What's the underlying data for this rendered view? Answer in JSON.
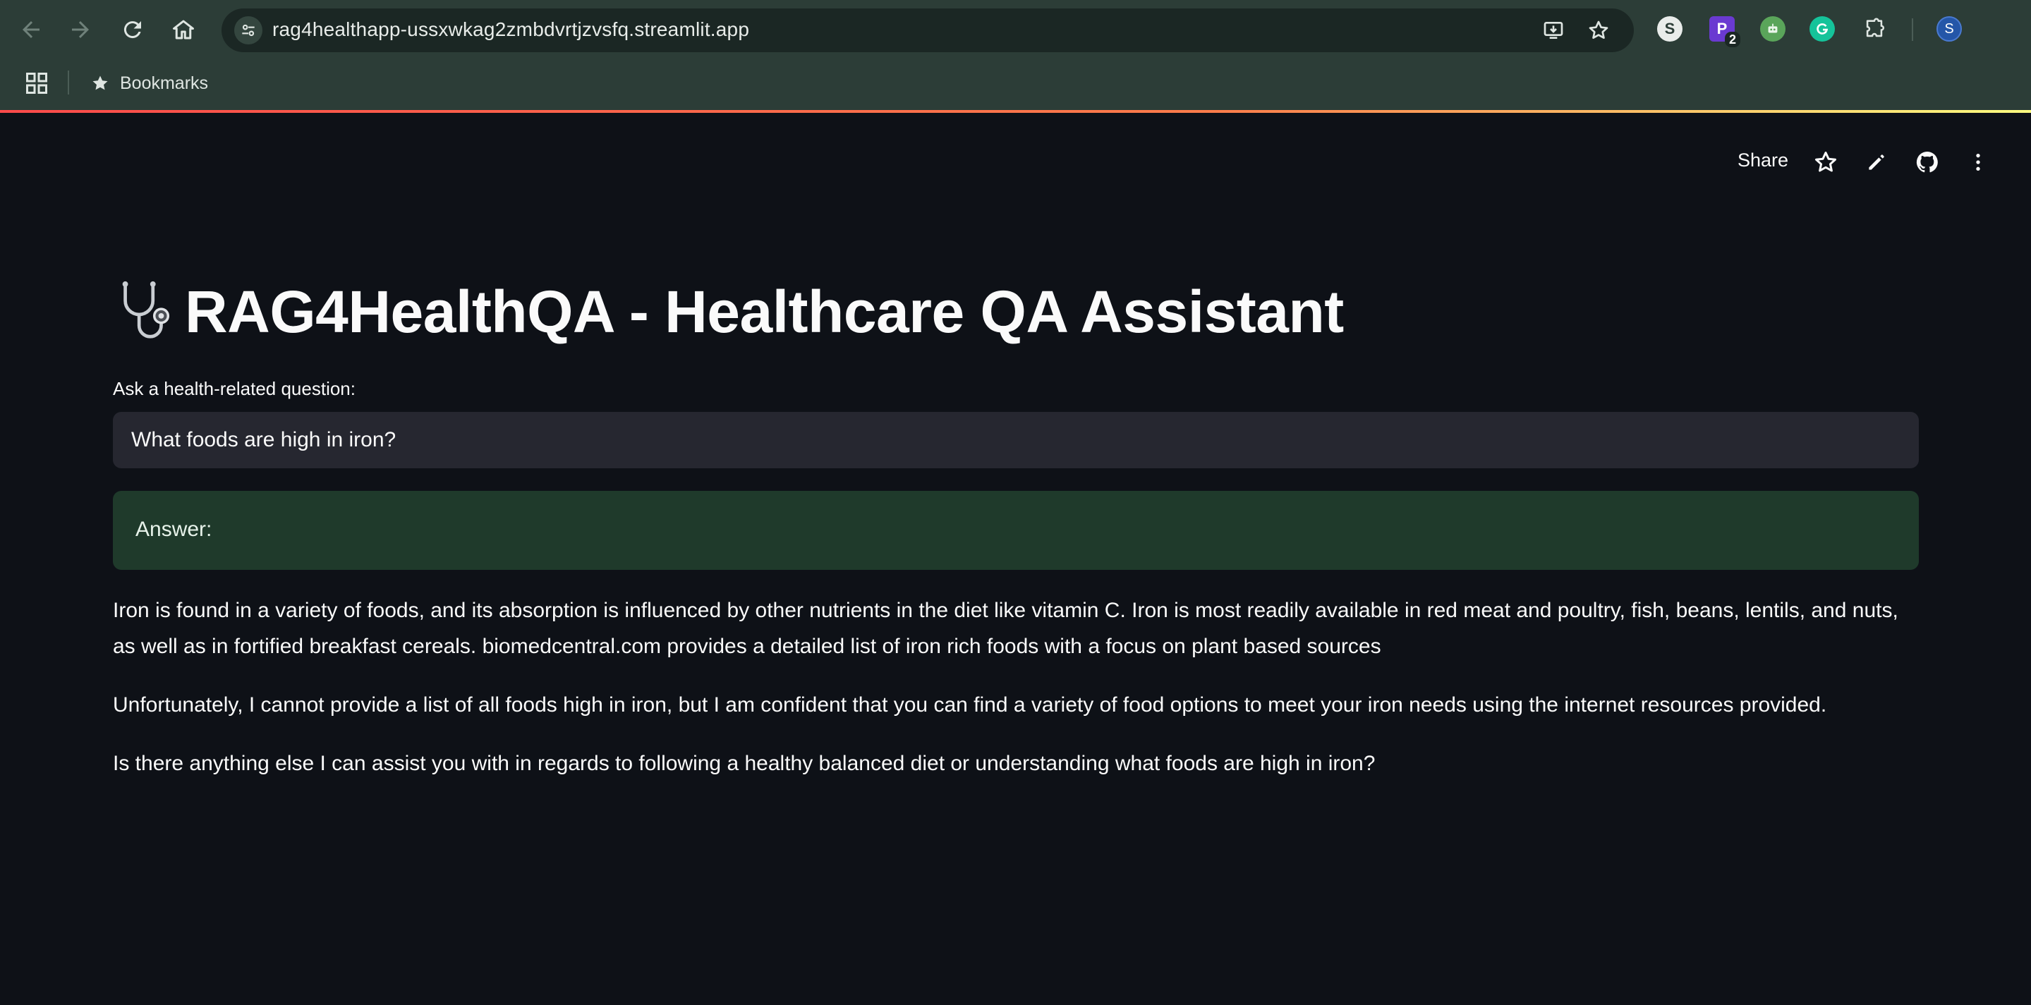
{
  "browser": {
    "url": "rag4healthapp-ussxwkag2zmbdvrtjzvsfq.streamlit.app",
    "bookmarks_label": "Bookmarks",
    "extension_badge": "2",
    "profile_initial": "S"
  },
  "app": {
    "share_label": "Share",
    "title": "RAG4HealthQA - Healthcare QA Assistant",
    "question_label": "Ask a health-related question:",
    "question_value": "What foods are high in iron?",
    "answer_label": "Answer:",
    "answer_paragraphs": [
      "Iron is found in a variety of foods, and its absorption is influenced by other nutrients in the diet like vitamin C. Iron is most readily available in red meat and poultry, fish, beans, lentils, and nuts, as well as in fortified breakfast cereals. biomedcentral.com provides a detailed list of iron rich foods with a focus on plant based sources",
      "Unfortunately, I cannot provide a list of all foods high in iron, but I am confident that you can find a variety of food options to meet your iron needs using the internet resources provided.",
      "Is there anything else I can assist you with in regards to following a healthy balanced diet or understanding what foods are high in iron?"
    ]
  },
  "colors": {
    "chrome_bg": "#2c3d37",
    "app_bg": "#0e1117",
    "input_bg": "#262730",
    "answer_bg": "#1f3a2b",
    "accent": "#ff4b4b"
  },
  "icons": [
    "back-icon",
    "forward-icon",
    "reload-icon",
    "home-icon",
    "site-settings-icon",
    "install-app-icon",
    "bookmark-star-icon",
    "extension-s-icon",
    "extension-p-icon",
    "extension-bot-icon",
    "grammarly-icon",
    "extensions-puzzle-icon",
    "profile-avatar",
    "apps-grid-icon",
    "star-icon",
    "edit-pencil-icon",
    "github-icon",
    "more-vert-icon",
    "stethoscope-icon"
  ]
}
